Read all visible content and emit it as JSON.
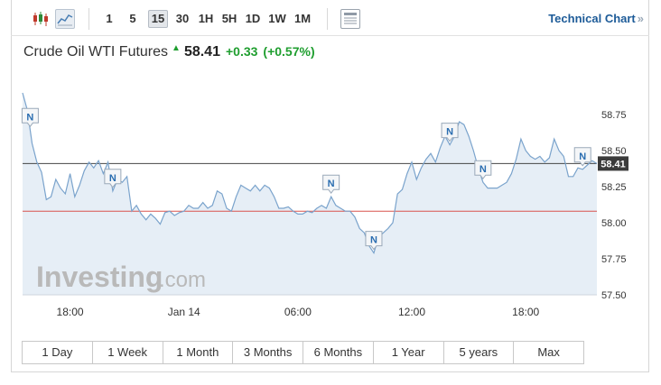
{
  "toolbar": {
    "timeframes": [
      "1",
      "5",
      "15",
      "30",
      "1H",
      "5H",
      "1D",
      "1W",
      "1M"
    ],
    "active_timeframe": "15",
    "technical_link": "Technical Chart",
    "link_chevron": "»"
  },
  "quote": {
    "name": "Crude Oil WTI Futures",
    "price": "58.41",
    "change": "+0.33",
    "change_pct": "(+0.57%)",
    "direction_icon": "up-arrow-icon",
    "up_color": "#1f9e2f"
  },
  "watermark": {
    "brand": "Investing",
    "suffix": ".com"
  },
  "ranges": [
    "1 Day",
    "1 Week",
    "1 Month",
    "3 Months",
    "6 Months",
    "1 Year",
    "5 years",
    "Max"
  ],
  "chart_data": {
    "type": "area",
    "title": "",
    "xlabel": "",
    "ylabel": "",
    "ylim": [
      57.5,
      59.0
    ],
    "yticks": [
      57.5,
      57.75,
      58.0,
      58.25,
      58.5,
      58.75
    ],
    "xticks": [
      {
        "label": "18:00",
        "t": 5.0
      },
      {
        "label": "Jan 14",
        "t": 17.0
      },
      {
        "label": "06:00",
        "t": 29.0
      },
      {
        "label": "12:00",
        "t": 41.0
      },
      {
        "label": "18:00",
        "t": 53.0
      }
    ],
    "grid": false,
    "series": [
      {
        "x": [
          0.0,
          0.5,
          1.0,
          1.5,
          2.0,
          2.5,
          3.0,
          3.5,
          4.0,
          4.5,
          5.0,
          5.5,
          6.0,
          6.5,
          7.0,
          7.5,
          8.0,
          8.5,
          9.0,
          9.5,
          10.0,
          10.5,
          11.0,
          11.5,
          12.0,
          12.5,
          13.0,
          13.5,
          14.0,
          14.5,
          15.0,
          15.5,
          16.0,
          16.5,
          17.0,
          17.5,
          18.0,
          18.5,
          19.0,
          19.5,
          20.0,
          20.5,
          21.0,
          21.5,
          22.0,
          22.5,
          23.0,
          23.5,
          24.0,
          24.5,
          25.0,
          25.5,
          26.0,
          26.5,
          27.0,
          27.5,
          28.0,
          28.5,
          29.0,
          29.5,
          30.0,
          30.5,
          31.0,
          31.5,
          32.0,
          32.5,
          33.0,
          33.5,
          34.0,
          34.5,
          35.0,
          35.5,
          36.0,
          36.5,
          37.0,
          37.5,
          38.0,
          38.5,
          39.0,
          39.5,
          40.0,
          40.5,
          41.0,
          41.5,
          42.0,
          42.5,
          43.0,
          43.5,
          44.0,
          44.5,
          45.0,
          45.5,
          46.0,
          46.5,
          47.0,
          47.5,
          48.0,
          48.5,
          49.0,
          49.5,
          50.0,
          50.5,
          51.0,
          51.5,
          52.0,
          52.5,
          53.0,
          53.5,
          54.0,
          54.5,
          55.0,
          55.5,
          56.0,
          56.5,
          57.0,
          57.5,
          58.0,
          58.5,
          59.0,
          59.5,
          60.0,
          60.5
        ],
        "values": [
          58.9,
          58.78,
          58.55,
          58.42,
          58.35,
          58.16,
          58.18,
          58.3,
          58.24,
          58.2,
          58.34,
          58.18,
          58.26,
          58.36,
          58.42,
          58.38,
          58.43,
          58.34,
          58.42,
          58.22,
          58.3,
          58.28,
          58.32,
          58.08,
          58.12,
          58.06,
          58.02,
          58.06,
          58.03,
          57.99,
          58.07,
          58.08,
          58.05,
          58.07,
          58.08,
          58.12,
          58.1,
          58.1,
          58.14,
          58.1,
          58.12,
          58.22,
          58.2,
          58.1,
          58.08,
          58.18,
          58.26,
          58.24,
          58.22,
          58.26,
          58.22,
          58.26,
          58.24,
          58.18,
          58.1,
          58.1,
          58.11,
          58.08,
          58.06,
          58.06,
          58.08,
          58.07,
          58.1,
          58.12,
          58.1,
          58.18,
          58.12,
          58.1,
          58.08,
          58.08,
          58.04,
          57.96,
          57.93,
          57.84,
          57.79,
          57.9,
          57.93,
          57.96,
          58.0,
          58.2,
          58.23,
          58.34,
          58.42,
          58.3,
          58.38,
          58.44,
          58.48,
          58.42,
          58.52,
          58.6,
          58.54,
          58.6,
          58.7,
          58.68,
          58.6,
          58.5,
          58.38,
          58.28,
          58.24,
          58.24,
          58.24,
          58.26,
          58.28,
          58.34,
          58.44,
          58.58,
          58.5,
          58.46,
          58.44,
          58.46,
          58.42,
          58.45,
          58.58,
          58.5,
          58.46,
          58.32,
          58.32,
          58.38,
          58.37,
          58.4,
          58.43,
          58.41
        ]
      }
    ],
    "reference_lines": [
      {
        "value": 58.41,
        "color": "#444444",
        "label": "58.41"
      },
      {
        "value": 58.08,
        "color": "#d9534f"
      }
    ],
    "news_markers": [
      {
        "t": 0.8,
        "label": "N"
      },
      {
        "t": 9.5,
        "label": "N"
      },
      {
        "t": 32.5,
        "label": "N"
      },
      {
        "t": 37.0,
        "label": "N"
      },
      {
        "t": 45.0,
        "label": "N"
      },
      {
        "t": 48.5,
        "label": "N"
      },
      {
        "t": 59.0,
        "label": "N"
      }
    ],
    "line_color": "#7aa3cc",
    "fill_color": "#e6eef6"
  }
}
